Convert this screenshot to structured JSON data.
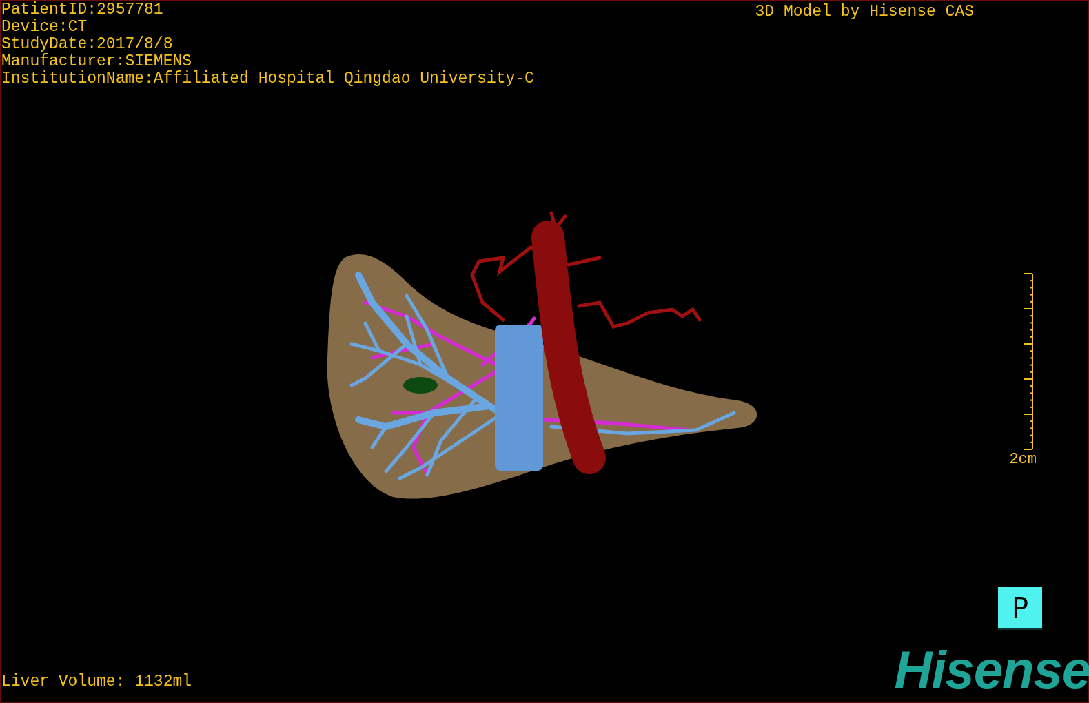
{
  "patient_info": [
    "PatientID:2957781",
    "Device:CT",
    "StudyDate:2017/8/8",
    "Manufacturer:SIEMENS",
    "InstitutionName:Affiliated Hospital Qingdao University-C"
  ],
  "title": "3D Model by Hisense CAS",
  "scale_bar": {
    "label": "2cm"
  },
  "orientation_button": {
    "label": "P"
  },
  "liver_volume": "Liver Volume: 1132ml",
  "logo": "Hisense"
}
